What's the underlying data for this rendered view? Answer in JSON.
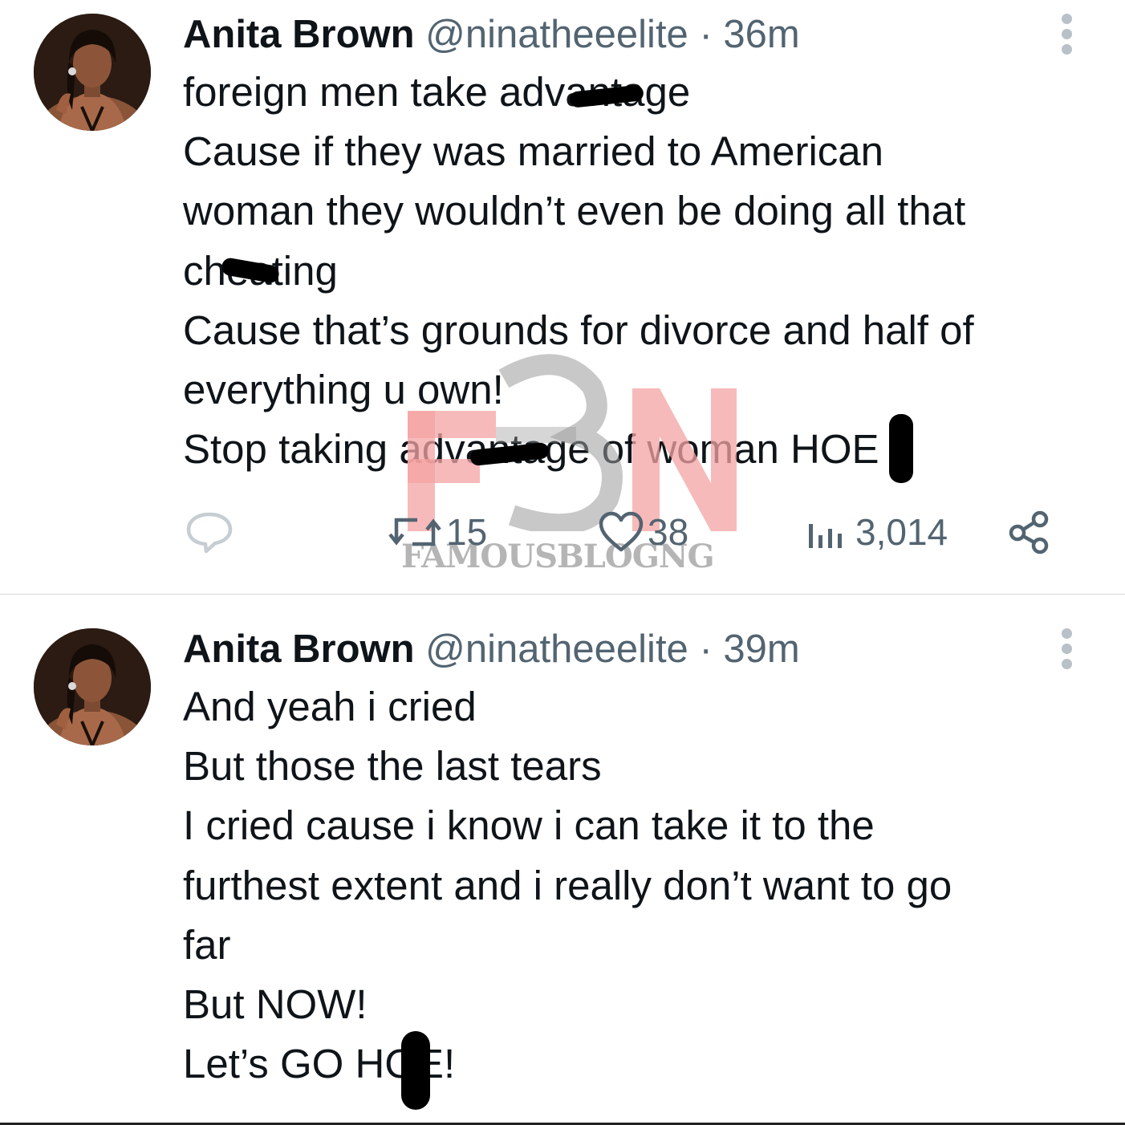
{
  "tweets": [
    {
      "author_name": "Anita Brown",
      "handle": "@ninatheeelite",
      "separator": "·",
      "time": "36m",
      "lines": [
        "foreign men take advantage",
        "Cause if they was married to American",
        "woman they wouldn’t even be doing all that",
        "cheating",
        "Cause that’s grounds for divorce and half of",
        "everything u own!",
        "Stop taking advantage of woman HOE"
      ],
      "stats": {
        "retweets": "15",
        "likes": "38",
        "views": "3,014"
      }
    },
    {
      "author_name": "Anita Brown",
      "handle": "@ninatheeelite",
      "separator": "·",
      "time": "39m",
      "lines": [
        "And yeah i cried",
        "But those the last tears",
        "I cried cause i know i can take it to the",
        "furthest extent and i really don’t want to go",
        "far",
        "But NOW!",
        "Let’s GO HOE!"
      ]
    }
  ],
  "watermark": {
    "logo_text": "FBN",
    "caption": "FAMOUSBLOGNG"
  },
  "icons": {
    "reply": "reply-icon",
    "retweet": "retweet-icon",
    "like": "heart-icon",
    "views": "views-icon",
    "share": "share-icon",
    "more": "more-vertical-icon"
  },
  "colors": {
    "text": "#0f1419",
    "secondary": "#536471",
    "watermark": "#f4a3a3"
  }
}
